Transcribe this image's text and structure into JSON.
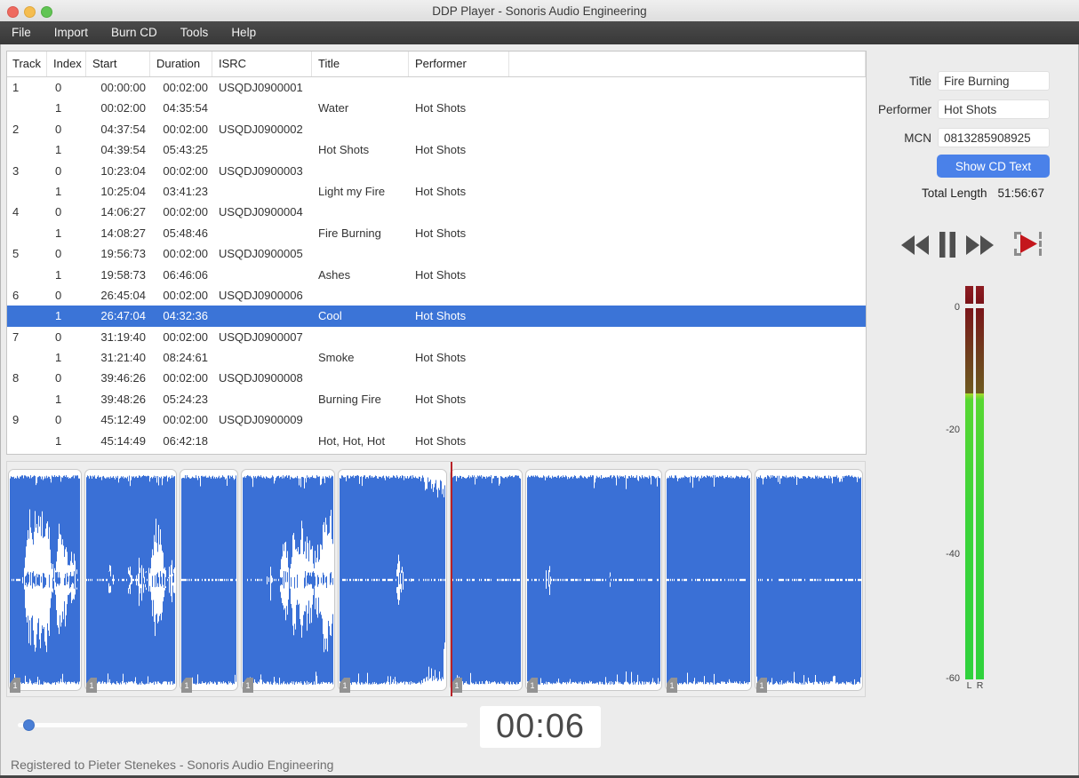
{
  "window": {
    "title": "DDP Player - Sonoris Audio Engineering"
  },
  "menu": {
    "items": [
      "File",
      "Import",
      "Burn CD",
      "Tools",
      "Help"
    ]
  },
  "table": {
    "columns": [
      "Track",
      "Index",
      "Start",
      "Duration",
      "ISRC",
      "Title",
      "Performer"
    ],
    "rows": [
      {
        "track": "1",
        "index": "0",
        "start": "00:00:00",
        "duration": "00:02:00",
        "isrc": "USQDJ0900001",
        "title": "",
        "performer": "",
        "selected": false
      },
      {
        "track": "",
        "index": "1",
        "start": "00:02:00",
        "duration": "04:35:54",
        "isrc": "",
        "title": "Water",
        "performer": "Hot Shots",
        "selected": false
      },
      {
        "track": "2",
        "index": "0",
        "start": "04:37:54",
        "duration": "00:02:00",
        "isrc": "USQDJ0900002",
        "title": "",
        "performer": "",
        "selected": false
      },
      {
        "track": "",
        "index": "1",
        "start": "04:39:54",
        "duration": "05:43:25",
        "isrc": "",
        "title": "Hot Shots",
        "performer": "Hot Shots",
        "selected": false
      },
      {
        "track": "3",
        "index": "0",
        "start": "10:23:04",
        "duration": "00:02:00",
        "isrc": "USQDJ0900003",
        "title": "",
        "performer": "",
        "selected": false
      },
      {
        "track": "",
        "index": "1",
        "start": "10:25:04",
        "duration": "03:41:23",
        "isrc": "",
        "title": "Light my Fire",
        "performer": "Hot Shots",
        "selected": false
      },
      {
        "track": "4",
        "index": "0",
        "start": "14:06:27",
        "duration": "00:02:00",
        "isrc": "USQDJ0900004",
        "title": "",
        "performer": "",
        "selected": false
      },
      {
        "track": "",
        "index": "1",
        "start": "14:08:27",
        "duration": "05:48:46",
        "isrc": "",
        "title": "Fire Burning",
        "performer": "Hot Shots",
        "selected": false
      },
      {
        "track": "5",
        "index": "0",
        "start": "19:56:73",
        "duration": "00:02:00",
        "isrc": "USQDJ0900005",
        "title": "",
        "performer": "",
        "selected": false
      },
      {
        "track": "",
        "index": "1",
        "start": "19:58:73",
        "duration": "06:46:06",
        "isrc": "",
        "title": "Ashes",
        "performer": "Hot Shots",
        "selected": false
      },
      {
        "track": "6",
        "index": "0",
        "start": "26:45:04",
        "duration": "00:02:00",
        "isrc": "USQDJ0900006",
        "title": "",
        "performer": "",
        "selected": false
      },
      {
        "track": "",
        "index": "1",
        "start": "26:47:04",
        "duration": "04:32:36",
        "isrc": "",
        "title": "Cool",
        "performer": "Hot Shots",
        "selected": true
      },
      {
        "track": "7",
        "index": "0",
        "start": "31:19:40",
        "duration": "00:02:00",
        "isrc": "USQDJ0900007",
        "title": "",
        "performer": "",
        "selected": false
      },
      {
        "track": "",
        "index": "1",
        "start": "31:21:40",
        "duration": "08:24:61",
        "isrc": "",
        "title": "Smoke",
        "performer": "Hot Shots",
        "selected": false
      },
      {
        "track": "8",
        "index": "0",
        "start": "39:46:26",
        "duration": "00:02:00",
        "isrc": "USQDJ0900008",
        "title": "",
        "performer": "",
        "selected": false
      },
      {
        "track": "",
        "index": "1",
        "start": "39:48:26",
        "duration": "05:24:23",
        "isrc": "",
        "title": "Burning Fire",
        "performer": "Hot Shots",
        "selected": false
      },
      {
        "track": "9",
        "index": "0",
        "start": "45:12:49",
        "duration": "00:02:00",
        "isrc": "USQDJ0900009",
        "title": "",
        "performer": "",
        "selected": false
      },
      {
        "track": "",
        "index": "1",
        "start": "45:14:49",
        "duration": "06:42:18",
        "isrc": "",
        "title": "Hot, Hot, Hot",
        "performer": "Hot Shots",
        "selected": false
      }
    ]
  },
  "side": {
    "title_label": "Title",
    "title_value": "Fire Burning",
    "performer_label": "Performer",
    "performer_value": "Hot Shots",
    "mcn_label": "MCN",
    "mcn_value": "0813285908925",
    "cd_text_button": "Show CD Text",
    "total_length_label": "Total Length",
    "total_length_value": "51:56:67"
  },
  "meter": {
    "scale": [
      "0",
      "-20",
      "-40",
      "-60"
    ],
    "channels": [
      "L",
      "R"
    ]
  },
  "player": {
    "time": "00:06",
    "playhead_fraction": 0.517
  },
  "waveform": {
    "segment_starts": [
      "00:00:00",
      "04:37:54",
      "10:23:04",
      "14:06:27",
      "19:56:73",
      "26:45:04",
      "31:19:40",
      "39:46:26",
      "45:12:49"
    ],
    "total_length": "51:56:67",
    "index_badge": "1"
  },
  "status": {
    "text": "Registered to Pieter Stenekes - Sonoris Audio Engineering"
  },
  "colors": {
    "selection_blue": "#3b74d7",
    "waveform_blue": "#3a70d6",
    "button_blue": "#4a81e9",
    "playhead_red": "#b82228",
    "meter_green": "#3bd43a"
  }
}
